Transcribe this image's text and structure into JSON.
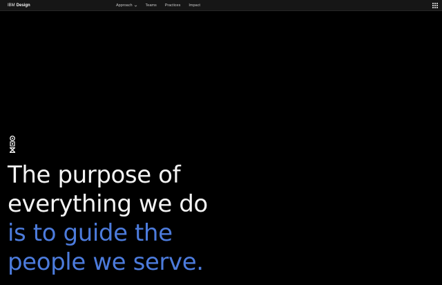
{
  "nav": {
    "brand_prefix": "IBM",
    "brand_name": "Design",
    "links": [
      {
        "label": "Approach",
        "has_dropdown": true
      },
      {
        "label": "Teams",
        "has_dropdown": false
      },
      {
        "label": "Practices",
        "has_dropdown": false
      },
      {
        "label": "Impact",
        "has_dropdown": false
      }
    ],
    "right_icon": "app-switcher-grid-icon"
  },
  "hero": {
    "mascot_icon": "robot-figure-icon",
    "headline_lines": [
      {
        "text": "The purpose of",
        "tone": "white"
      },
      {
        "text": "everything we do",
        "tone": "white"
      },
      {
        "text": "is to guide the",
        "tone": "blue"
      },
      {
        "text": "people we serve.",
        "tone": "blue"
      }
    ]
  },
  "colors": {
    "background": "#000000",
    "nav_background": "#161616",
    "text_primary": "#f4f4f4",
    "accent_blue": "#4c7bdc"
  }
}
